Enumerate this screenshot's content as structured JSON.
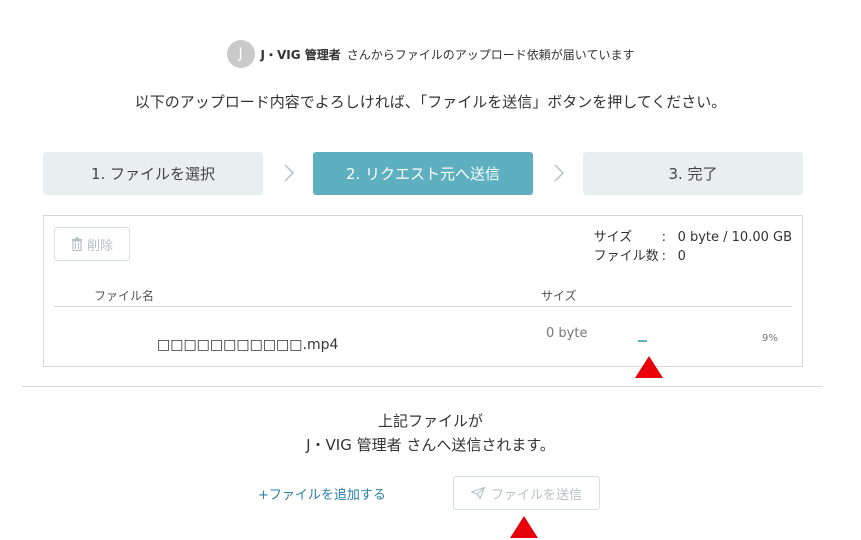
{
  "requester": {
    "avatar_initial": "J",
    "name": "J・VIG 管理者",
    "message": "さんからファイルのアップロード依頼が届いています"
  },
  "instruction": "以下のアップロード内容でよろしければ、「ファイルを送信」ボタンを押してください。",
  "steps": [
    {
      "label": "1. ファイルを選択",
      "active": false
    },
    {
      "label": "2. リクエスト元へ送信",
      "active": true
    },
    {
      "label": "3. 完了",
      "active": false
    }
  ],
  "file_panel": {
    "delete_label": "削除",
    "size_label": "サイズ",
    "size_value": "0 byte / 10.00 GB",
    "count_label": "ファイル数",
    "count_value": "0",
    "colon": ":",
    "columns": {
      "name": "ファイル名",
      "size": "サイズ"
    },
    "rows": [
      {
        "name": "□□□□□□□□□□□.mp4",
        "size": "0 byte",
        "progress_percent": 9,
        "percent_label": "9%"
      }
    ]
  },
  "confirm": {
    "line1": "上記ファイルが",
    "line2": "J・VIG 管理者 さんへ送信されます。"
  },
  "actions": {
    "add_files": "+ファイルを追加する",
    "send": "ファイルを送信"
  },
  "colors": {
    "accent": "#5eafc0",
    "link": "#2a7fa8",
    "marker": "#e8000b"
  },
  "icons": {
    "delete": "trash-icon",
    "send": "paper-plane-icon",
    "step_separator": "chevron-right-icon"
  }
}
